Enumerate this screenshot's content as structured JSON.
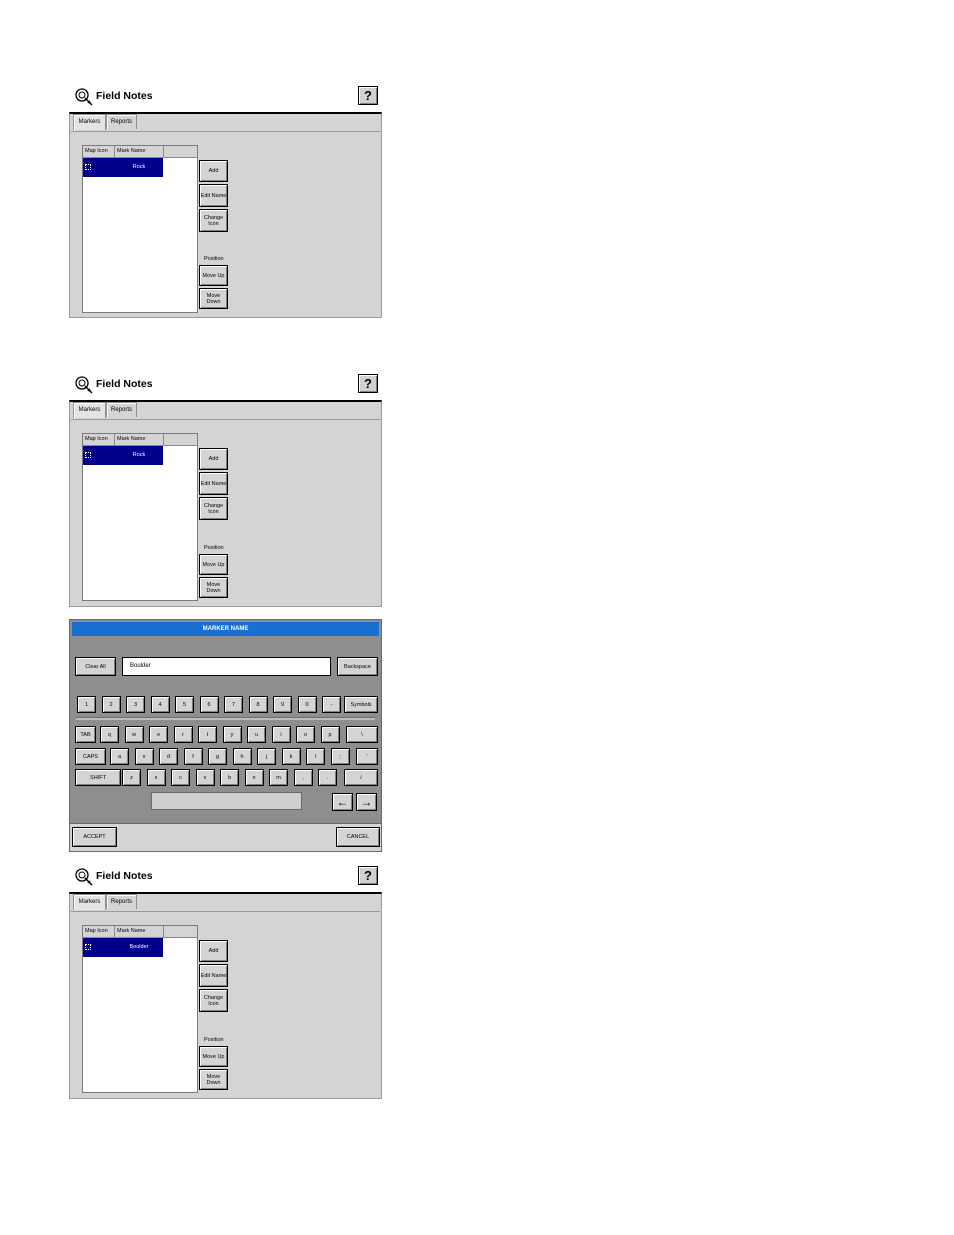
{
  "screens": [
    {
      "title": "Field Notes",
      "help": "?",
      "tabs": [
        "Markers",
        "Reports"
      ],
      "columns": [
        "Map Icon",
        "Mark Name"
      ],
      "row_name": "Rock",
      "buttons": {
        "add": "Add",
        "edit_name": "Edit Name",
        "change_icon": "Change Icon",
        "position": "Position",
        "move_up": "Move Up",
        "move_down": "Move Down"
      }
    },
    {
      "title": "Field Notes",
      "help": "?",
      "tabs": [
        "Markers",
        "Reports"
      ],
      "columns": [
        "Map Icon",
        "Mark Name"
      ],
      "row_name": "Rock",
      "buttons": {
        "add": "Add",
        "edit_name": "Edit Name",
        "change_icon": "Change Icon",
        "position": "Position",
        "move_up": "Move Up",
        "move_down": "Move Down"
      }
    },
    {
      "title": "Field Notes",
      "help": "?",
      "tabs": [
        "Markers",
        "Reports"
      ],
      "columns": [
        "Map Icon",
        "Mark Name"
      ],
      "row_name": "Boulder",
      "buttons": {
        "add": "Add",
        "edit_name": "Edit Name",
        "change_icon": "Change Icon",
        "position": "Position",
        "move_up": "Move Up",
        "move_down": "Move Down"
      }
    }
  ],
  "keyboard": {
    "title": "MARKER NAME",
    "clear_all": "Clear All",
    "input_value": "Boulder",
    "backspace": "Backspace",
    "row1": [
      "1",
      "2",
      "3",
      "4",
      "5",
      "6",
      "7",
      "8",
      "9",
      "0",
      "-",
      "Symbols"
    ],
    "row2": [
      "TAB",
      "q",
      "w",
      "e",
      "r",
      "t",
      "y",
      "u",
      "i",
      "o",
      "p",
      "\\"
    ],
    "row3": [
      "CAPS",
      "a",
      "s",
      "d",
      "f",
      "g",
      "h",
      "j",
      "k",
      "l",
      ";",
      "'"
    ],
    "row4": [
      "SHIFT",
      "z",
      "x",
      "c",
      "v",
      "b",
      "n",
      "m",
      ",",
      ".",
      "/"
    ],
    "left_arrow": "←",
    "right_arrow": "→",
    "accept": "ACCEPT",
    "cancel": "CANCEL"
  },
  "colors": {
    "selection": "#00008b",
    "title_bar": "#1a6fd2",
    "panel": "#d4d4d4"
  }
}
